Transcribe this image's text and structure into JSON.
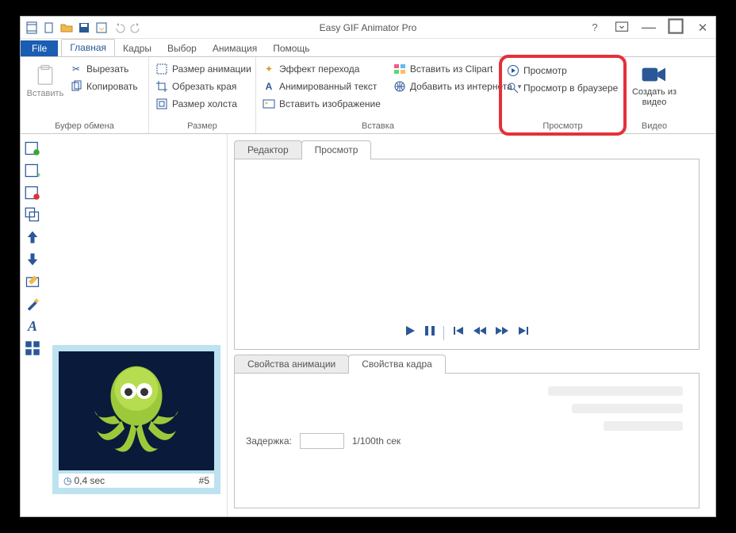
{
  "title": "Easy GIF Animator Pro",
  "file_tab": "File",
  "tabs": [
    "Главная",
    "Кадры",
    "Выбор",
    "Анимация",
    "Помощь"
  ],
  "active_tab": 0,
  "ribbon": {
    "clipboard": {
      "paste": "Вставить",
      "cut": "Вырезать",
      "copy": "Копировать",
      "label": "Буфер обмена"
    },
    "size": {
      "anim_size": "Размер анимации",
      "crop": "Обрезать края",
      "canvas_size": "Размер холста",
      "label": "Размер"
    },
    "insert": {
      "transition": "Эффект перехода",
      "anim_text": "Анимированный текст",
      "insert_image": "Вставить изображение",
      "from_clipart": "Вставить из Clipart",
      "from_internet": "Добавить из интернета",
      "label": "Вставка"
    },
    "preview": {
      "preview": "Просмотр",
      "preview_browser": "Просмотр в браузере",
      "label": "Просмотр"
    },
    "video": {
      "create": "Создать из видео",
      "label": "Видео"
    }
  },
  "editor_tabs": {
    "editor": "Редактор",
    "preview": "Просмотр"
  },
  "props_tabs": {
    "anim": "Свойства анимации",
    "frame": "Свойства кадра"
  },
  "delay_label": "Задержка:",
  "delay_value": "",
  "delay_unit": "1/100th сек",
  "frame": {
    "time": "0,4 sec",
    "num": "#5"
  }
}
